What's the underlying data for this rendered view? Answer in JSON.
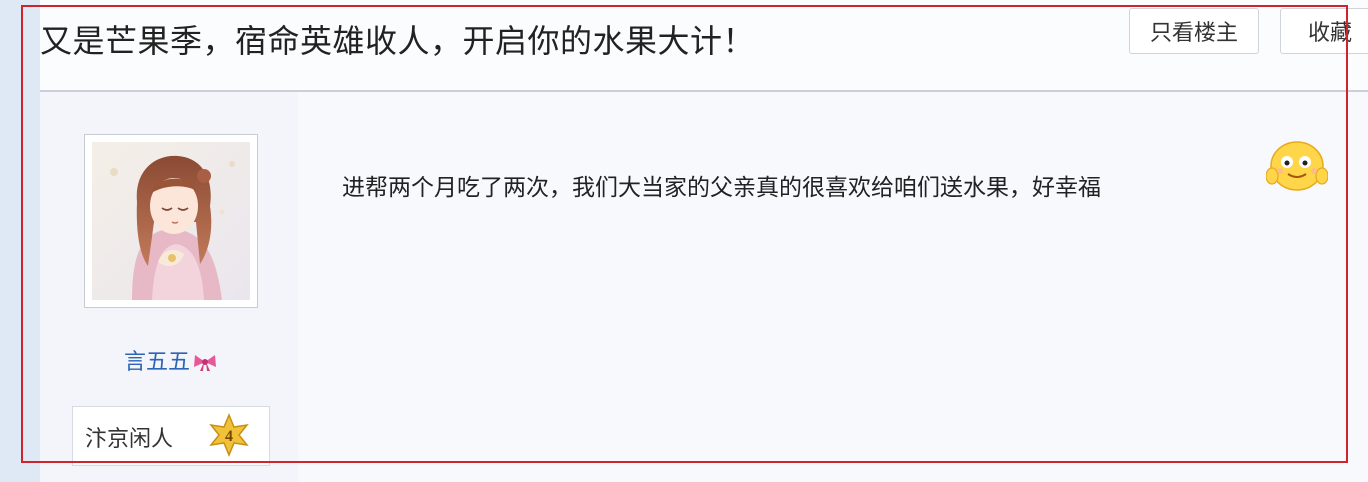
{
  "post": {
    "title": "又是芒果季，宿命英雄收人，开启你的水果大计！",
    "buttons": {
      "only_op": "只看楼主",
      "favorite": "收藏"
    }
  },
  "author": {
    "avatar_icon": "anime-girl-avatar",
    "username": "言五五",
    "username_icon": "pink-bow-icon",
    "level_title": "汴京闲人",
    "level_number": "4"
  },
  "reply": {
    "text": "进帮两个月吃了两次，我们大当家的父亲真的很喜欢给咱们送水果，好幸福",
    "emoji_icon": "grinning-emoji"
  },
  "colors": {
    "username": "#2d64b3",
    "highlight_frame": "#d0232e",
    "badge": "#f0c23a"
  }
}
